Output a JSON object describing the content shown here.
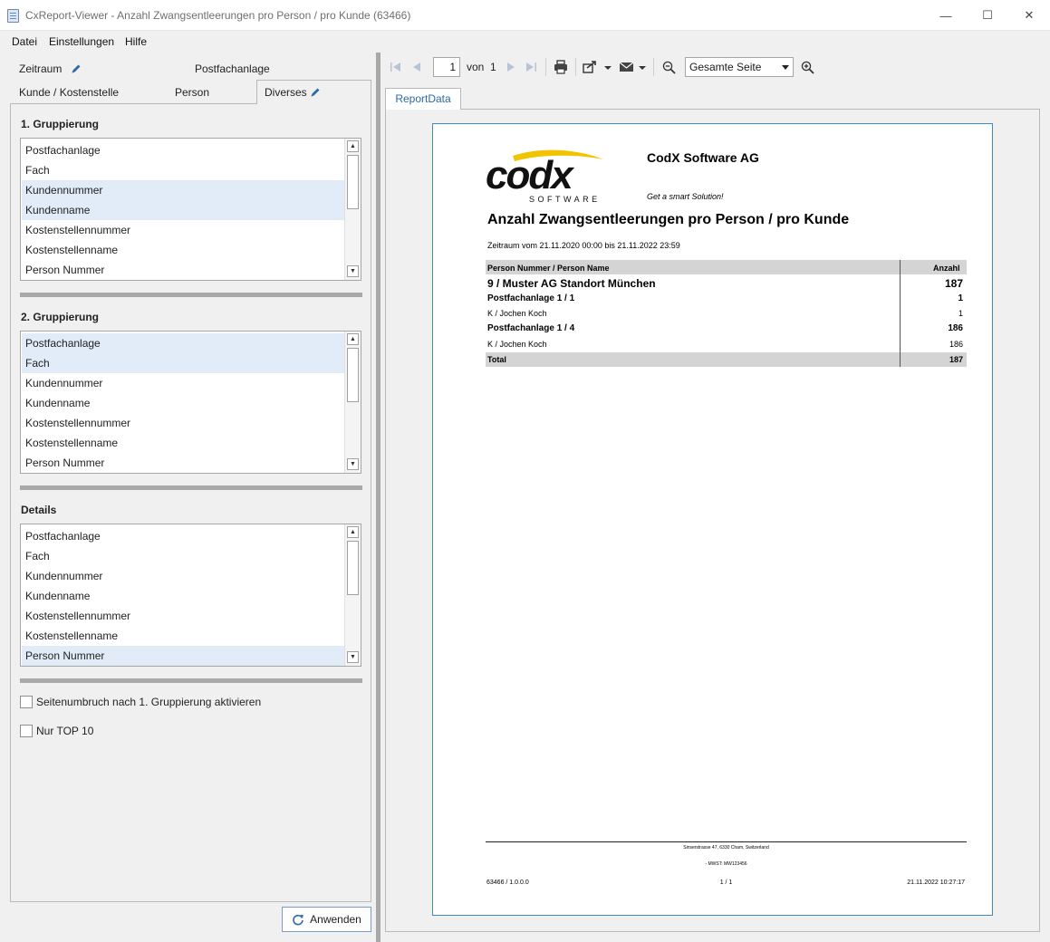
{
  "window": {
    "title": "CxReport-Viewer - Anzahl Zwangsentleerungen pro Person / pro Kunde (63466)",
    "minimize": "—",
    "maximize": "☐",
    "close": "✕"
  },
  "menu": [
    "Datei",
    "Einstellungen",
    "Hilfe"
  ],
  "filter_tabs": {
    "zeitraum": "Zeitraum",
    "postfachanlage": "Postfachanlage",
    "kunde": "Kunde / Kostenstelle",
    "person": "Person",
    "diverses": "Diverses"
  },
  "groups": [
    {
      "title": "1. Gruppierung",
      "items": [
        "Postfachanlage",
        "Fach",
        "Kundennummer",
        "Kundenname",
        "Kostenstellennummer",
        "Kostenstellenname",
        "Person Nummer"
      ],
      "selected": [
        2,
        3
      ]
    },
    {
      "title": "2. Gruppierung",
      "items": [
        "Postfachanlage",
        "Fach",
        "Kundennummer",
        "Kundenname",
        "Kostenstellennummer",
        "Kostenstellenname",
        "Person Nummer"
      ],
      "selected": [
        0,
        1
      ]
    },
    {
      "title": "Details",
      "items": [
        "Postfachanlage",
        "Fach",
        "Kundennummer",
        "Kundenname",
        "Kostenstellennummer",
        "Kostenstellenname",
        "Person Nummer"
      ],
      "selected": [
        6
      ]
    }
  ],
  "options": {
    "pagebreak": "Seitenumbruch nach 1. Gruppierung aktivieren",
    "top10": "Nur TOP 10"
  },
  "apply_label": "Anwenden",
  "toolbar": {
    "page": "1",
    "of_label": "von",
    "total_pages": "1",
    "zoom": "Gesamte Seite"
  },
  "report_tab": "ReportData",
  "report": {
    "company": "CodX Software AG",
    "slogan": "Get a smart Solution!",
    "logo_text": "codx",
    "logo_sub": "SOFTWARE",
    "title": "Anzahl Zwangsentleerungen pro Person / pro Kunde",
    "period": "Zeitraum vom 21.11.2020 00:00 bis 21.11.2022 23:59",
    "col_name": "Person Nummer / Person Name",
    "col_count": "Anzahl",
    "rows": [
      {
        "label": "9 / Muster AG Standort München",
        "value": "187",
        "level": 1
      },
      {
        "label": "Postfachanlage 1 / 1",
        "value": "1",
        "level": 2
      },
      {
        "label": "K / Jochen  Koch",
        "value": "1",
        "level": 3
      },
      {
        "label": "Postfachanlage 1 / 4",
        "value": "186",
        "level": 2
      },
      {
        "label": "K / Jochen  Koch",
        "value": "186",
        "level": 3
      }
    ],
    "total_label": "Total",
    "total_value": "187",
    "footer_address": "Sinserstrasse 47,  6330 Cham,  Switzerland",
    "footer_vat": "- MWST: MW123456",
    "footer_version": "63466 / 1.0.0.0",
    "footer_page": "1 / 1",
    "footer_date": "21.11.2022 10:27:17"
  },
  "colors": {
    "accent": "#2b6aa6",
    "selection": "#e1ecf8",
    "logo_yellow": "#f2c400"
  }
}
